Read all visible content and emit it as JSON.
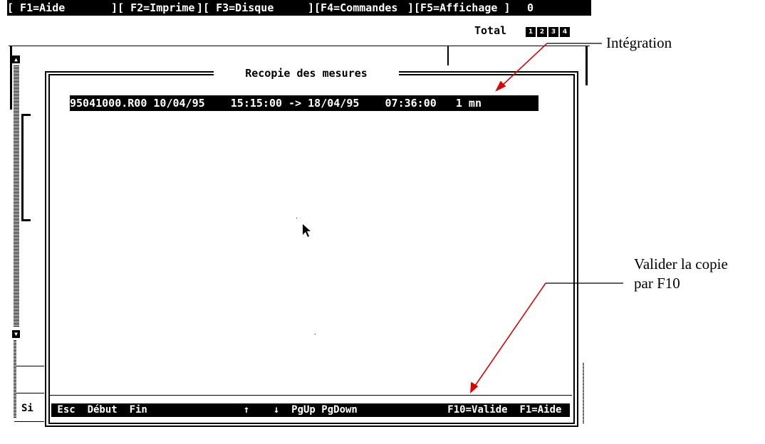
{
  "menubar": {
    "items": [
      "[ F1=Aide",
      "][ F2=Imprime",
      "][ F3=Disque",
      "][F4=Commandes",
      "][F5=Affichage ]",
      "0"
    ]
  },
  "header": {
    "total_label": "Total",
    "screen_numbers": [
      "1",
      "2",
      "3",
      "4"
    ]
  },
  "dialog": {
    "title": "Recopie des mesures",
    "record": "95041000.R00 10/04/95    15:15:00 -> 18/04/95    07:36:00   1 mn"
  },
  "statusbar": {
    "text": " Esc  Début  Fin                ↑    ↓  PgUp PgDown               F10=Valide  F1=Aide"
  },
  "left_panel": {
    "label": "Si"
  },
  "annotations": {
    "integration": "Intégration",
    "validate_line1": "Valider la copie",
    "validate_line2": "par F10"
  },
  "colors": {
    "annotation_arrow": "#e00000",
    "screen_fg": "#000000",
    "screen_bg": "#ffffff"
  }
}
